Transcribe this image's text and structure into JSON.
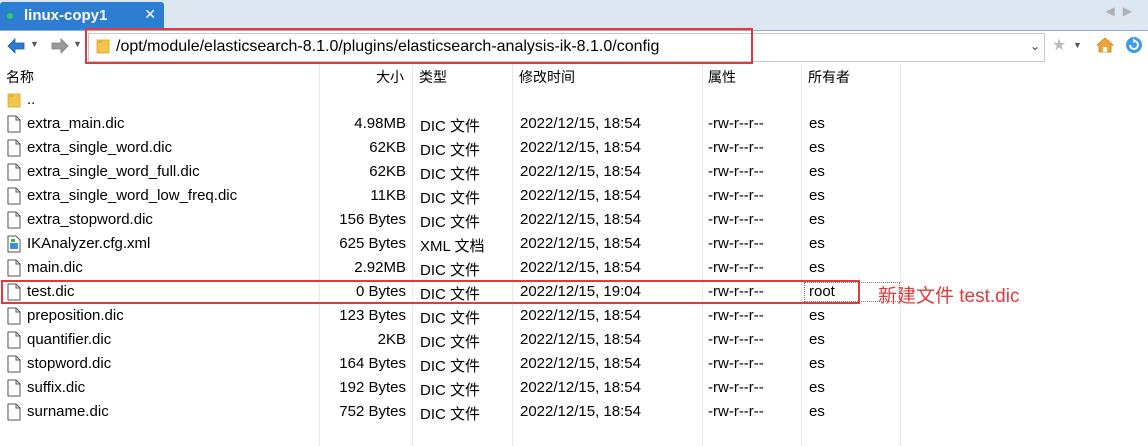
{
  "tab": {
    "title": "linux-copy1",
    "close": "✕"
  },
  "scroll": {
    "left": "◀",
    "right": "▶"
  },
  "toolbar": {
    "back_icon": "back-arrow-icon",
    "forward_icon": "forward-arrow-icon",
    "dropdown_glyph": "▼",
    "address": "/opt/module/elasticsearch-8.1.0/plugins/elasticsearch-analysis-ik-8.1.0/config",
    "address_dropdown": "⌄",
    "star": "★",
    "home_icon": "home-icon",
    "refresh_icon": "refresh-icon"
  },
  "columns": {
    "name": "名称",
    "size": "大小",
    "type": "类型",
    "mtime": "修改时间",
    "attr": "属性",
    "owner": "所有者"
  },
  "files": [
    {
      "icon": "folder-icon",
      "name": "..",
      "size": "",
      "type": "",
      "mtime": "",
      "attr": "",
      "owner": ""
    },
    {
      "icon": "file-icon",
      "name": "extra_main.dic",
      "size": "4.98MB",
      "type": "DIC 文件",
      "mtime": "2022/12/15, 18:54",
      "attr": "-rw-r--r--",
      "owner": "es"
    },
    {
      "icon": "file-icon",
      "name": "extra_single_word.dic",
      "size": "62KB",
      "type": "DIC 文件",
      "mtime": "2022/12/15, 18:54",
      "attr": "-rw-r--r--",
      "owner": "es"
    },
    {
      "icon": "file-icon",
      "name": "extra_single_word_full.dic",
      "size": "62KB",
      "type": "DIC 文件",
      "mtime": "2022/12/15, 18:54",
      "attr": "-rw-r--r--",
      "owner": "es"
    },
    {
      "icon": "file-icon",
      "name": "extra_single_word_low_freq.dic",
      "size": "11KB",
      "type": "DIC 文件",
      "mtime": "2022/12/15, 18:54",
      "attr": "-rw-r--r--",
      "owner": "es"
    },
    {
      "icon": "file-icon",
      "name": "extra_stopword.dic",
      "size": "156 Bytes",
      "type": "DIC 文件",
      "mtime": "2022/12/15, 18:54",
      "attr": "-rw-r--r--",
      "owner": "es"
    },
    {
      "icon": "xml-file-icon",
      "name": "IKAnalyzer.cfg.xml",
      "size": "625 Bytes",
      "type": "XML 文档",
      "mtime": "2022/12/15, 18:54",
      "attr": "-rw-r--r--",
      "owner": "es"
    },
    {
      "icon": "file-icon",
      "name": "main.dic",
      "size": "2.92MB",
      "type": "DIC 文件",
      "mtime": "2022/12/15, 18:54",
      "attr": "-rw-r--r--",
      "owner": "es"
    },
    {
      "icon": "file-icon",
      "name": "test.dic",
      "size": "0 Bytes",
      "type": "DIC 文件",
      "mtime": "2022/12/15, 19:04",
      "attr": "-rw-r--r--",
      "owner": "root"
    },
    {
      "icon": "file-icon",
      "name": "preposition.dic",
      "size": "123 Bytes",
      "type": "DIC 文件",
      "mtime": "2022/12/15, 18:54",
      "attr": "-rw-r--r--",
      "owner": "es"
    },
    {
      "icon": "file-icon",
      "name": "quantifier.dic",
      "size": "2KB",
      "type": "DIC 文件",
      "mtime": "2022/12/15, 18:54",
      "attr": "-rw-r--r--",
      "owner": "es"
    },
    {
      "icon": "file-icon",
      "name": "stopword.dic",
      "size": "164 Bytes",
      "type": "DIC 文件",
      "mtime": "2022/12/15, 18:54",
      "attr": "-rw-r--r--",
      "owner": "es"
    },
    {
      "icon": "file-icon",
      "name": "suffix.dic",
      "size": "192 Bytes",
      "type": "DIC 文件",
      "mtime": "2022/12/15, 18:54",
      "attr": "-rw-r--r--",
      "owner": "es"
    },
    {
      "icon": "file-icon",
      "name": "surname.dic",
      "size": "752 Bytes",
      "type": "DIC 文件",
      "mtime": "2022/12/15, 18:54",
      "attr": "-rw-r--r--",
      "owner": "es"
    }
  ],
  "annotation": "新建文件 test.dic",
  "colors": {
    "tab": "#2d7dd2",
    "highlight": "#e23a3a",
    "annotation": "#e23a3a"
  }
}
